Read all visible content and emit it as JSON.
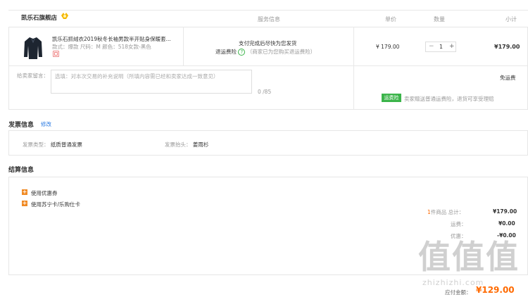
{
  "header": {
    "store_name": "凯乐石旗舰店",
    "col_service": "服务信息",
    "col_price": "单价",
    "col_qty": "数量",
    "col_subtotal": "小计"
  },
  "product": {
    "title": "凯乐石抓绒衣2019秋冬长袖男款半开贴身保暖套...",
    "attrs": "款式：爆款   尺码：M   颜色：518女款-黑色",
    "service_line1": "支付完成后尽快为您发货",
    "service_insurance": "退运费险",
    "service_help": "?",
    "service_note": "（商家已为您购买退运费险）",
    "unit_price": "¥ 179.00",
    "qty": "1",
    "qty_minus": "−",
    "qty_plus": "+",
    "subtotal": "¥179.00"
  },
  "remark": {
    "label": "给卖家留言：",
    "placeholder": "选填：对本次交易的补充说明（所填内容需已经和卖家达成一致意见）",
    "counter": "0 /85",
    "shipping": "免运费",
    "insurance_tag": "运费险",
    "insurance_text": "卖家赠送普通运费险，退货可享受理赔"
  },
  "invoice": {
    "title": "发票信息",
    "edit": "修改",
    "type_label": "发票类型：",
    "type_value": "纸质普通发票",
    "header_label": "发票抬头：",
    "header_value": "姜雨杉"
  },
  "settlement": {
    "title": "结算信息",
    "coupon": "使用优惠券",
    "card": "使用苏宁卡/乐购仕卡",
    "count_num": "1",
    "count_text": "件商品 总计：",
    "total": "¥179.00",
    "shipping_label": "运费：",
    "shipping_value": "¥0.00",
    "discount_label": "优惠：",
    "discount_value": "-¥0.00",
    "payable_label": "应付金额：",
    "payable_value": "¥129.00"
  },
  "watermark": {
    "glyphs": "值",
    "url": "zhizhizhi.com"
  }
}
